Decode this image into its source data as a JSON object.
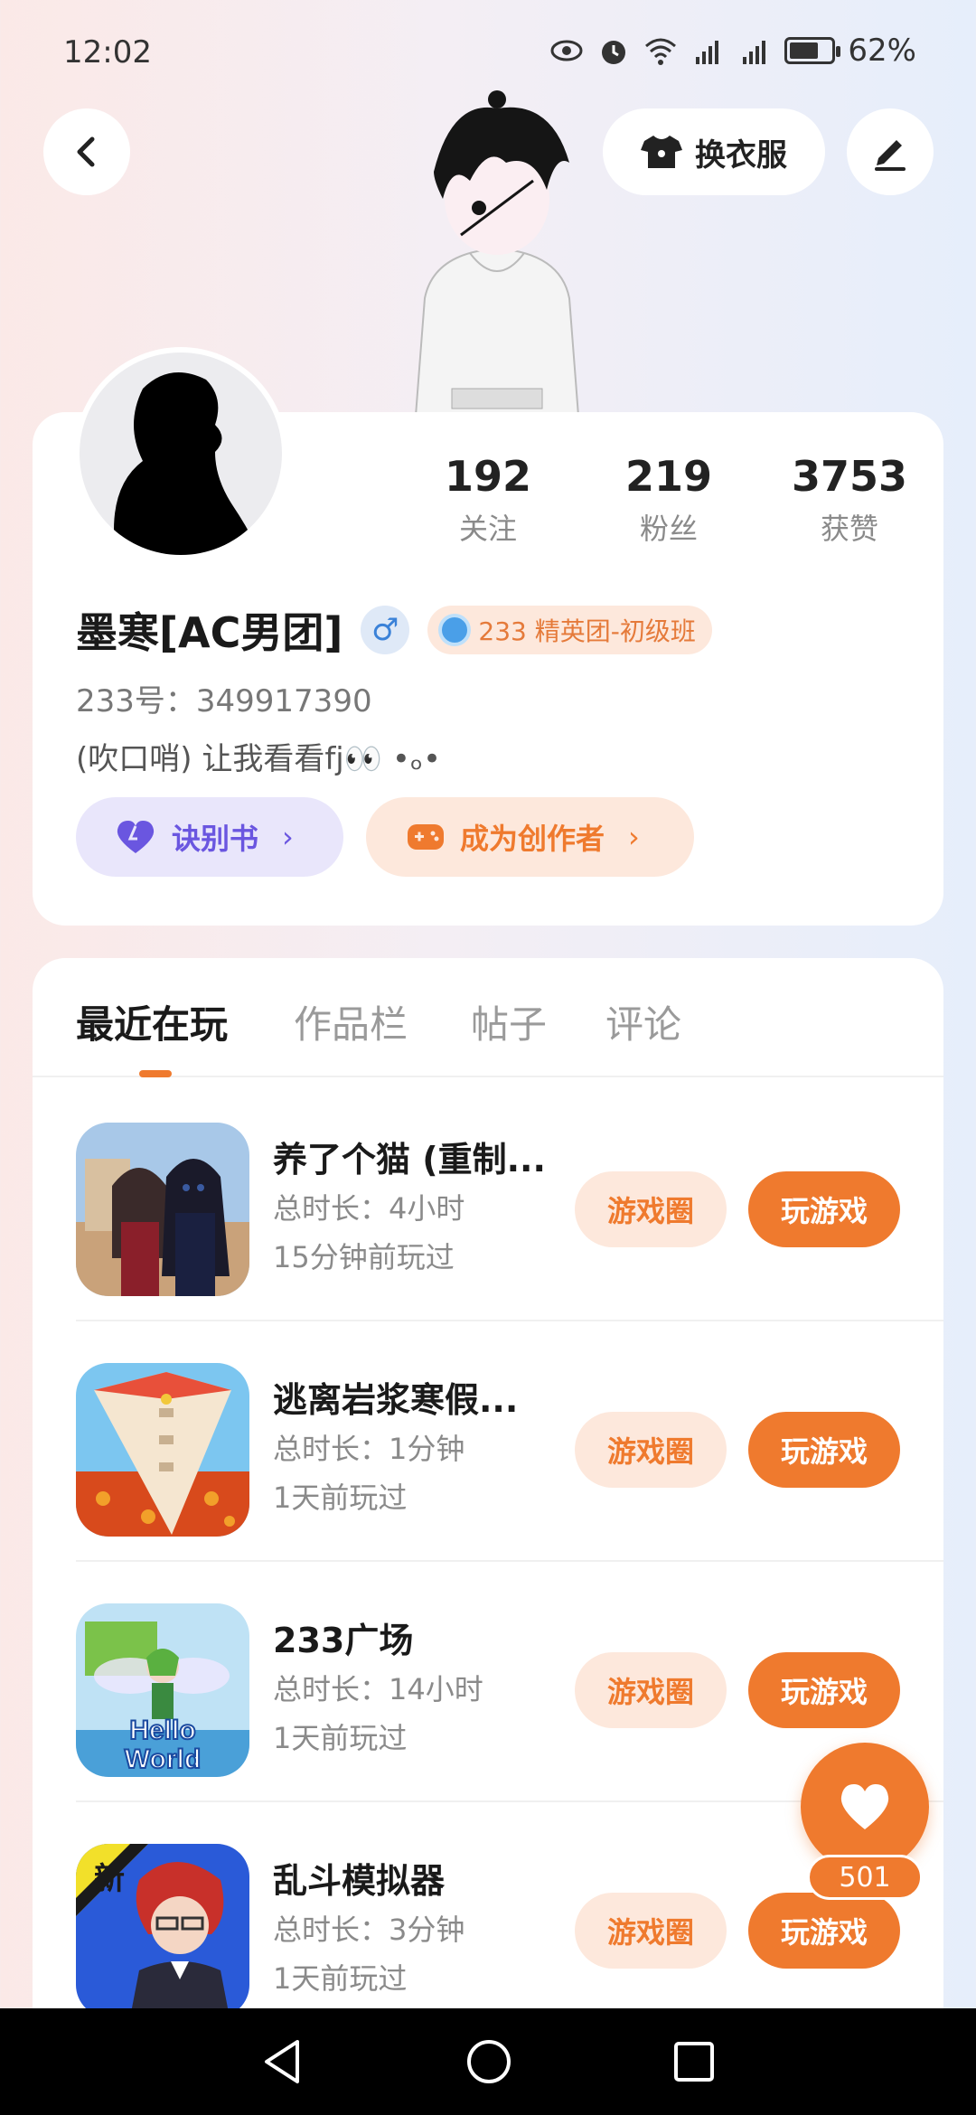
{
  "status_bar": {
    "time": "12:02",
    "battery": "62%",
    "battery_level": 0.62,
    "icons": [
      "eye-icon",
      "alarm-icon",
      "wifi-icon",
      "signal-4g-icon",
      "signal-4g-icon",
      "battery-icon"
    ]
  },
  "header": {
    "back_icon": "chevron-left-icon",
    "dress_label": "换衣服",
    "dress_icon": "shirt-icon",
    "edit_icon": "pen-icon"
  },
  "profile": {
    "stats": [
      {
        "value": "192",
        "label": "关注"
      },
      {
        "value": "219",
        "label": "粉丝"
      },
      {
        "value": "3753",
        "label": "获赞"
      }
    ],
    "nickname": "墨寒[AC男团]",
    "gender": "♂",
    "rank": "233 精英团-初级班",
    "user_id": "233号：349917390",
    "bio": "(吹口哨) 让我看看fj👀 •ₒ•",
    "book_label": "诀别书",
    "creator_label": "成为创作者",
    "arrow": "›"
  },
  "tabs": [
    "最近在玩",
    "作品栏",
    "帖子",
    "评论"
  ],
  "games": [
    {
      "title": "养了个猫 (重制...",
      "duration": "总时长：4小时",
      "last_played": "15分钟前玩过",
      "circle_label": "游戏圈",
      "play_label": "玩游戏"
    },
    {
      "title": "逃离岩浆寒假...",
      "duration": "总时长：1分钟",
      "last_played": "1天前玩过",
      "circle_label": "游戏圈",
      "play_label": "玩游戏"
    },
    {
      "title": "233广场",
      "duration": "总时长：14小时",
      "last_played": "1天前玩过",
      "circle_label": "游戏圈",
      "play_label": "玩游戏"
    },
    {
      "title": "乱斗模拟器",
      "duration": "总时长：3分钟",
      "last_played": "1天前玩过",
      "circle_label": "游戏圈",
      "play_label": "玩游戏"
    }
  ],
  "game_icon_texts": {
    "game3": "Hello World",
    "game4": "新"
  },
  "like": {
    "count": "501",
    "icon": "heart-icon"
  },
  "nav": [
    "back-triangle-icon",
    "home-circle-icon",
    "recents-square-icon"
  ],
  "colors": {
    "accent": "#ef7a2e",
    "accent_light": "#fde8dc",
    "purple": "#6a56e0",
    "purple_light": "#e9e6fb",
    "blue": "#3b82d8"
  }
}
